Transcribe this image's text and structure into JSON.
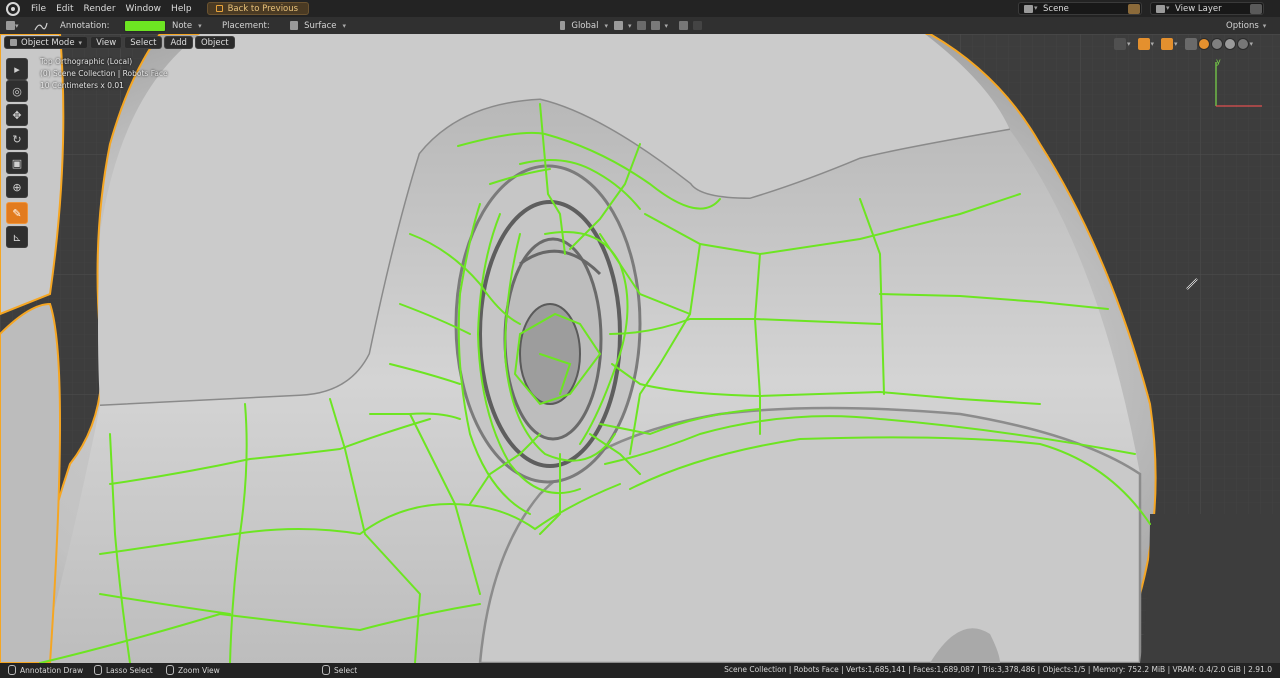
{
  "menu": {
    "items": [
      "File",
      "Edit",
      "Render",
      "Window",
      "Help"
    ],
    "back_button": "Back to Previous"
  },
  "scene": {
    "label": "Scene"
  },
  "view_layer": {
    "label": "View Layer"
  },
  "tool_header": {
    "annotation_label": "Annotation:",
    "annotation_color": "#6de522",
    "note_value": "Note",
    "placement_label": "Placement:",
    "placement_value": "Surface",
    "orientation_value": "Global",
    "options_label": "Options"
  },
  "viewport_header": {
    "mode": "Object Mode",
    "menus": [
      "View",
      "Select",
      "Add",
      "Object"
    ]
  },
  "viewport_info": {
    "line1": "Top Orthographic (Local)",
    "line2": "(0) Scene Collection | Robots Face",
    "line3": "10 Centimeters x 0.01"
  },
  "toolbar": {
    "tools": [
      {
        "name": "select-box",
        "icon": "cursor-icon"
      },
      {
        "name": "cursor",
        "icon": "target-icon"
      },
      {
        "name": "move",
        "icon": "move-icon"
      },
      {
        "name": "rotate",
        "icon": "rotate-icon"
      },
      {
        "name": "scale",
        "icon": "scale-icon"
      },
      {
        "name": "transform",
        "icon": "transform-icon"
      },
      {
        "name": "annotate",
        "icon": "pencil-icon",
        "active": true
      },
      {
        "name": "measure",
        "icon": "ruler-icon"
      }
    ]
  },
  "gizmo": {
    "axis_label": "y"
  },
  "status_bar": {
    "left": [
      "Annotation Draw",
      "Lasso Select",
      "Zoom View",
      "Select"
    ],
    "stats": "Scene Collection | Robots Face | Verts:1,685,141 | Faces:1,689,087 | Tris:3,378,486 | Objects:1/5 | Memory: 752.2 MiB | VRAM: 0.4/2.0 GiB | 2.91.0"
  },
  "colors": {
    "accent": "#e27b1e",
    "annotation": "#6de522",
    "outline": "#f5a623",
    "grid_bg": "#3d3d3d"
  }
}
